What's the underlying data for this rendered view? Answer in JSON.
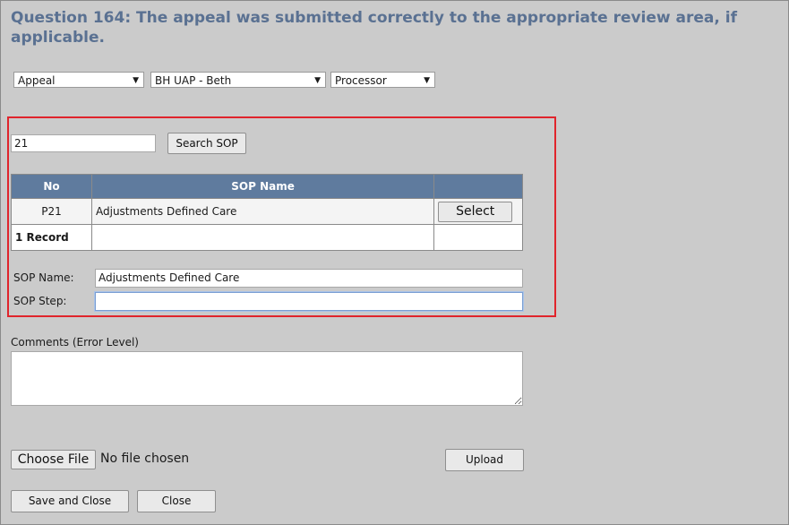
{
  "question": {
    "title": "Question 164:  The appeal was submitted correctly to the appropriate review area, if applicable."
  },
  "dropdowns": [
    {
      "selected": "Appeal"
    },
    {
      "selected": "BH UAP - Beth"
    },
    {
      "selected": "Processor"
    }
  ],
  "search": {
    "value": "21",
    "button_label": "Search SOP"
  },
  "table": {
    "headers": [
      "No",
      "SOP Name",
      ""
    ],
    "rows": [
      {
        "no": "P21",
        "name": "Adjustments Defined Care",
        "action": "Select"
      }
    ],
    "footer": "1 Record"
  },
  "sop_fields": {
    "name_label": "SOP Name:",
    "name_value": "Adjustments Defined Care",
    "step_label": "SOP Step:",
    "step_value": ""
  },
  "comments": {
    "label": "Comments (Error Level)",
    "value": ""
  },
  "file": {
    "choose_label": "Choose File",
    "status": "No file chosen",
    "upload_label": "Upload"
  },
  "footer_buttons": {
    "save_close": "Save and Close",
    "close": "Close"
  },
  "colors": {
    "title": "#5a7192",
    "table_header": "#5f7b9e",
    "highlight_border": "#e0242c",
    "focus_border": "#7b9fd3"
  }
}
